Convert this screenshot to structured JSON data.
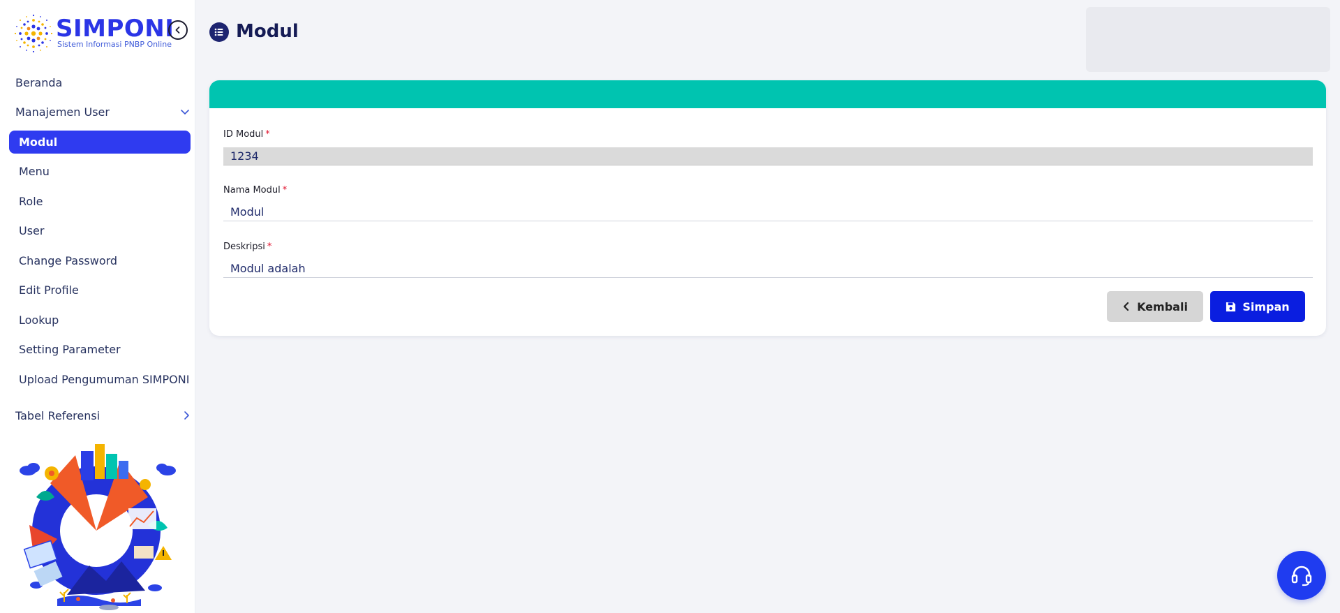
{
  "brand": {
    "name": "SIMPONI",
    "tagline": "Sistem Informasi PNBP Online"
  },
  "sidebar": {
    "items": [
      {
        "label": "Beranda"
      },
      {
        "label": "Manajemen User"
      },
      {
        "label": "Modul"
      },
      {
        "label": "Menu"
      },
      {
        "label": "Role"
      },
      {
        "label": "User"
      },
      {
        "label": "Change Password"
      },
      {
        "label": "Edit Profile"
      },
      {
        "label": "Lookup"
      },
      {
        "label": "Setting Parameter"
      },
      {
        "label": "Upload Pengumuman SIMPONI"
      },
      {
        "label": "Tabel Referensi"
      }
    ]
  },
  "page": {
    "title": "Modul"
  },
  "form": {
    "fields": [
      {
        "label": "ID Modul",
        "required": "*",
        "value": "1234"
      },
      {
        "label": "Nama Modul",
        "required": "*",
        "value": "Modul"
      },
      {
        "label": "Deskripsi",
        "required": "*",
        "value": "Modul adalah"
      }
    ],
    "back_label": "Kembali",
    "save_label": "Simpan"
  },
  "colors": {
    "brand_blue": "#2b35e6",
    "active_nav": "#2f3bf0",
    "card_header": "#00c4b0",
    "save_button": "#0a1ee0",
    "required_mark": "#e0102c"
  },
  "icons": {
    "collapse": "chevron-left-circle-icon",
    "page": "list-icon",
    "back": "chevron-left-icon",
    "save": "floppy-disk-icon",
    "help": "headset-icon"
  }
}
